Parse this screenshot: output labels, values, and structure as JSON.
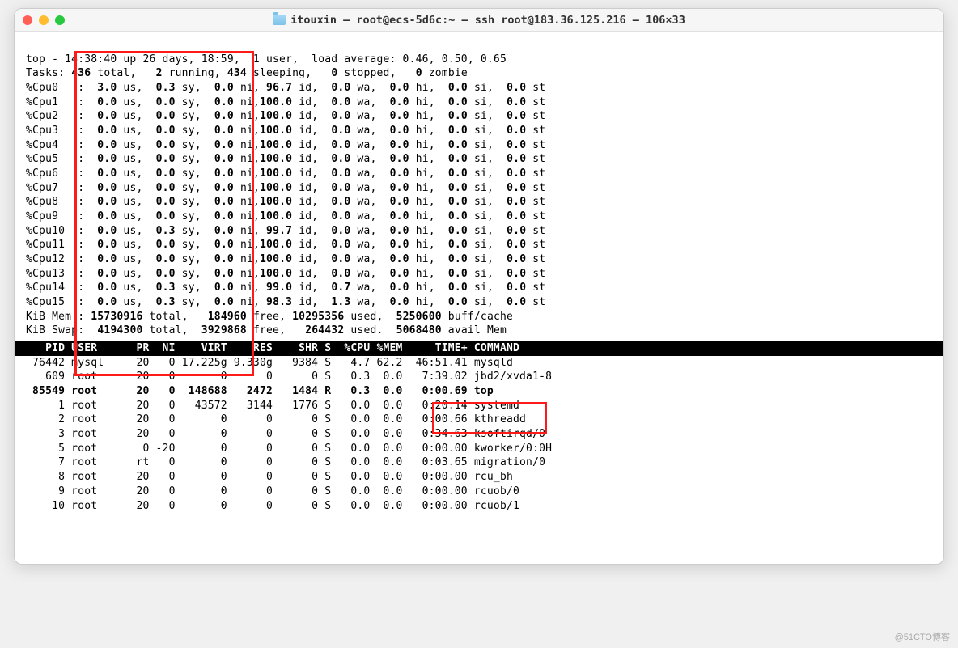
{
  "window": {
    "title": "itouxin — root@ecs-5d6c:~ — ssh root@183.36.125.216 — 106×33"
  },
  "top": {
    "summary": "top - 14:38:40 up 26 days, 18:59,  1 user,  load average: 0.46, 0.50, 0.65",
    "tasks": {
      "total": "436",
      "running": "2",
      "sleeping": "434",
      "stopped": "0",
      "zombie": "0"
    },
    "cpus": [
      {
        "name": "%Cpu0 ",
        "us": "3.0",
        "sy": "0.3",
        "ni": "0.0",
        "id": " 96.7",
        "wa": "0.0",
        "hi": "0.0",
        "si": "0.0",
        "st": "0.0"
      },
      {
        "name": "%Cpu1 ",
        "us": "0.0",
        "sy": "0.0",
        "ni": "0.0",
        "id": "100.0",
        "wa": "0.0",
        "hi": "0.0",
        "si": "0.0",
        "st": "0.0"
      },
      {
        "name": "%Cpu2 ",
        "us": "0.0",
        "sy": "0.0",
        "ni": "0.0",
        "id": "100.0",
        "wa": "0.0",
        "hi": "0.0",
        "si": "0.0",
        "st": "0.0"
      },
      {
        "name": "%Cpu3 ",
        "us": "0.0",
        "sy": "0.0",
        "ni": "0.0",
        "id": "100.0",
        "wa": "0.0",
        "hi": "0.0",
        "si": "0.0",
        "st": "0.0"
      },
      {
        "name": "%Cpu4 ",
        "us": "0.0",
        "sy": "0.0",
        "ni": "0.0",
        "id": "100.0",
        "wa": "0.0",
        "hi": "0.0",
        "si": "0.0",
        "st": "0.0"
      },
      {
        "name": "%Cpu5 ",
        "us": "0.0",
        "sy": "0.0",
        "ni": "0.0",
        "id": "100.0",
        "wa": "0.0",
        "hi": "0.0",
        "si": "0.0",
        "st": "0.0"
      },
      {
        "name": "%Cpu6 ",
        "us": "0.0",
        "sy": "0.0",
        "ni": "0.0",
        "id": "100.0",
        "wa": "0.0",
        "hi": "0.0",
        "si": "0.0",
        "st": "0.0"
      },
      {
        "name": "%Cpu7 ",
        "us": "0.0",
        "sy": "0.0",
        "ni": "0.0",
        "id": "100.0",
        "wa": "0.0",
        "hi": "0.0",
        "si": "0.0",
        "st": "0.0"
      },
      {
        "name": "%Cpu8 ",
        "us": "0.0",
        "sy": "0.0",
        "ni": "0.0",
        "id": "100.0",
        "wa": "0.0",
        "hi": "0.0",
        "si": "0.0",
        "st": "0.0"
      },
      {
        "name": "%Cpu9 ",
        "us": "0.0",
        "sy": "0.0",
        "ni": "0.0",
        "id": "100.0",
        "wa": "0.0",
        "hi": "0.0",
        "si": "0.0",
        "st": "0.0"
      },
      {
        "name": "%Cpu10",
        "us": "0.0",
        "sy": "0.3",
        "ni": "0.0",
        "id": " 99.7",
        "wa": "0.0",
        "hi": "0.0",
        "si": "0.0",
        "st": "0.0"
      },
      {
        "name": "%Cpu11",
        "us": "0.0",
        "sy": "0.0",
        "ni": "0.0",
        "id": "100.0",
        "wa": "0.0",
        "hi": "0.0",
        "si": "0.0",
        "st": "0.0"
      },
      {
        "name": "%Cpu12",
        "us": "0.0",
        "sy": "0.0",
        "ni": "0.0",
        "id": "100.0",
        "wa": "0.0",
        "hi": "0.0",
        "si": "0.0",
        "st": "0.0"
      },
      {
        "name": "%Cpu13",
        "us": "0.0",
        "sy": "0.0",
        "ni": "0.0",
        "id": "100.0",
        "wa": "0.0",
        "hi": "0.0",
        "si": "0.0",
        "st": "0.0"
      },
      {
        "name": "%Cpu14",
        "us": "0.0",
        "sy": "0.3",
        "ni": "0.0",
        "id": " 99.0",
        "wa": "0.7",
        "hi": "0.0",
        "si": "0.0",
        "st": "0.0"
      },
      {
        "name": "%Cpu15",
        "us": "0.0",
        "sy": "0.3",
        "ni": "0.0",
        "id": " 98.3",
        "wa": "1.3",
        "hi": "0.0",
        "si": "0.0",
        "st": "0.0"
      }
    ],
    "mem": {
      "label": "KiB Mem :",
      "total": "15730916",
      "free": "184960",
      "used": "10295356",
      "buff": "5250600",
      "buff_label": "buff/cache"
    },
    "swap": {
      "label": "KiB Swap:",
      "total": "4194300",
      "free": "3929868",
      "used": "264432",
      "avail": "5068480",
      "avail_label": "avail Mem"
    },
    "header": "   PID USER      PR  NI    VIRT    RES    SHR S  %CPU %MEM     TIME+ COMMAND                           ",
    "procs": [
      {
        "pid": "76442",
        "user": "mysql",
        "pr": "20",
        "ni": "0",
        "virt": "17.225g",
        "res": "9.330g",
        "shr": "9384",
        "s": "S",
        "cpu": "4.7",
        "mem": "62.2",
        "time": "46:51.41",
        "cmd": "mysqld",
        "bold": false
      },
      {
        "pid": "609",
        "user": "root",
        "pr": "20",
        "ni": "0",
        "virt": "0",
        "res": "0",
        "shr": "0",
        "s": "S",
        "cpu": "0.3",
        "mem": "0.0",
        "time": "7:39.02",
        "cmd": "jbd2/xvda1-8",
        "bold": false
      },
      {
        "pid": "85549",
        "user": "root",
        "pr": "20",
        "ni": "0",
        "virt": "148688",
        "res": "2472",
        "shr": "1484",
        "s": "R",
        "cpu": "0.3",
        "mem": "0.0",
        "time": "0:00.69",
        "cmd": "top",
        "bold": true
      },
      {
        "pid": "1",
        "user": "root",
        "pr": "20",
        "ni": "0",
        "virt": "43572",
        "res": "3144",
        "shr": "1776",
        "s": "S",
        "cpu": "0.0",
        "mem": "0.0",
        "time": "0:20.14",
        "cmd": "systemd",
        "bold": false
      },
      {
        "pid": "2",
        "user": "root",
        "pr": "20",
        "ni": "0",
        "virt": "0",
        "res": "0",
        "shr": "0",
        "s": "S",
        "cpu": "0.0",
        "mem": "0.0",
        "time": "0:00.66",
        "cmd": "kthreadd",
        "bold": false
      },
      {
        "pid": "3",
        "user": "root",
        "pr": "20",
        "ni": "0",
        "virt": "0",
        "res": "0",
        "shr": "0",
        "s": "S",
        "cpu": "0.0",
        "mem": "0.0",
        "time": "0:34.63",
        "cmd": "ksoftirqd/0",
        "bold": false
      },
      {
        "pid": "5",
        "user": "root",
        "pr": "0",
        "ni": "-20",
        "virt": "0",
        "res": "0",
        "shr": "0",
        "s": "S",
        "cpu": "0.0",
        "mem": "0.0",
        "time": "0:00.00",
        "cmd": "kworker/0:0H",
        "bold": false
      },
      {
        "pid": "7",
        "user": "root",
        "pr": "rt",
        "ni": "0",
        "virt": "0",
        "res": "0",
        "shr": "0",
        "s": "S",
        "cpu": "0.0",
        "mem": "0.0",
        "time": "0:03.65",
        "cmd": "migration/0",
        "bold": false
      },
      {
        "pid": "8",
        "user": "root",
        "pr": "20",
        "ni": "0",
        "virt": "0",
        "res": "0",
        "shr": "0",
        "s": "S",
        "cpu": "0.0",
        "mem": "0.0",
        "time": "0:00.00",
        "cmd": "rcu_bh",
        "bold": false
      },
      {
        "pid": "9",
        "user": "root",
        "pr": "20",
        "ni": "0",
        "virt": "0",
        "res": "0",
        "shr": "0",
        "s": "S",
        "cpu": "0.0",
        "mem": "0.0",
        "time": "0:00.00",
        "cmd": "rcuob/0",
        "bold": false
      },
      {
        "pid": "10",
        "user": "root",
        "pr": "20",
        "ni": "0",
        "virt": "0",
        "res": "0",
        "shr": "0",
        "s": "S",
        "cpu": "0.0",
        "mem": "0.0",
        "time": "0:00.00",
        "cmd": "rcuob/1",
        "bold": false
      }
    ]
  },
  "watermark": "@51CTO博客"
}
